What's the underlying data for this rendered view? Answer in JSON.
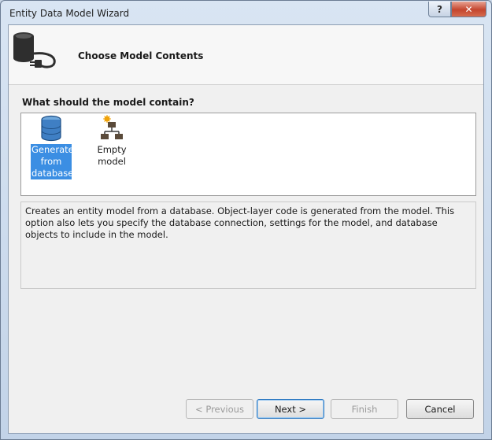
{
  "window": {
    "title": "Entity Data Model Wizard",
    "help_glyph": "?",
    "close_glyph": "✕"
  },
  "banner": {
    "title": "Choose Model Contents",
    "icon": "database-plug-icon"
  },
  "section": {
    "label": "What should the model contain?"
  },
  "choices": [
    {
      "label": "Generate from database",
      "icon": "database-icon",
      "selected": true
    },
    {
      "label": "Empty model",
      "icon": "hierarchy-icon",
      "selected": false
    }
  ],
  "description": "Creates an entity model from a database. Object-layer code is generated from the model. This option also lets you specify the database connection, settings for the model, and database objects to include in the model.",
  "buttons": {
    "previous": "< Previous",
    "next": "Next >",
    "finish": "Finish",
    "cancel": "Cancel"
  },
  "colors": {
    "selection": "#3b8ee3",
    "close_button": "#c4462e"
  }
}
